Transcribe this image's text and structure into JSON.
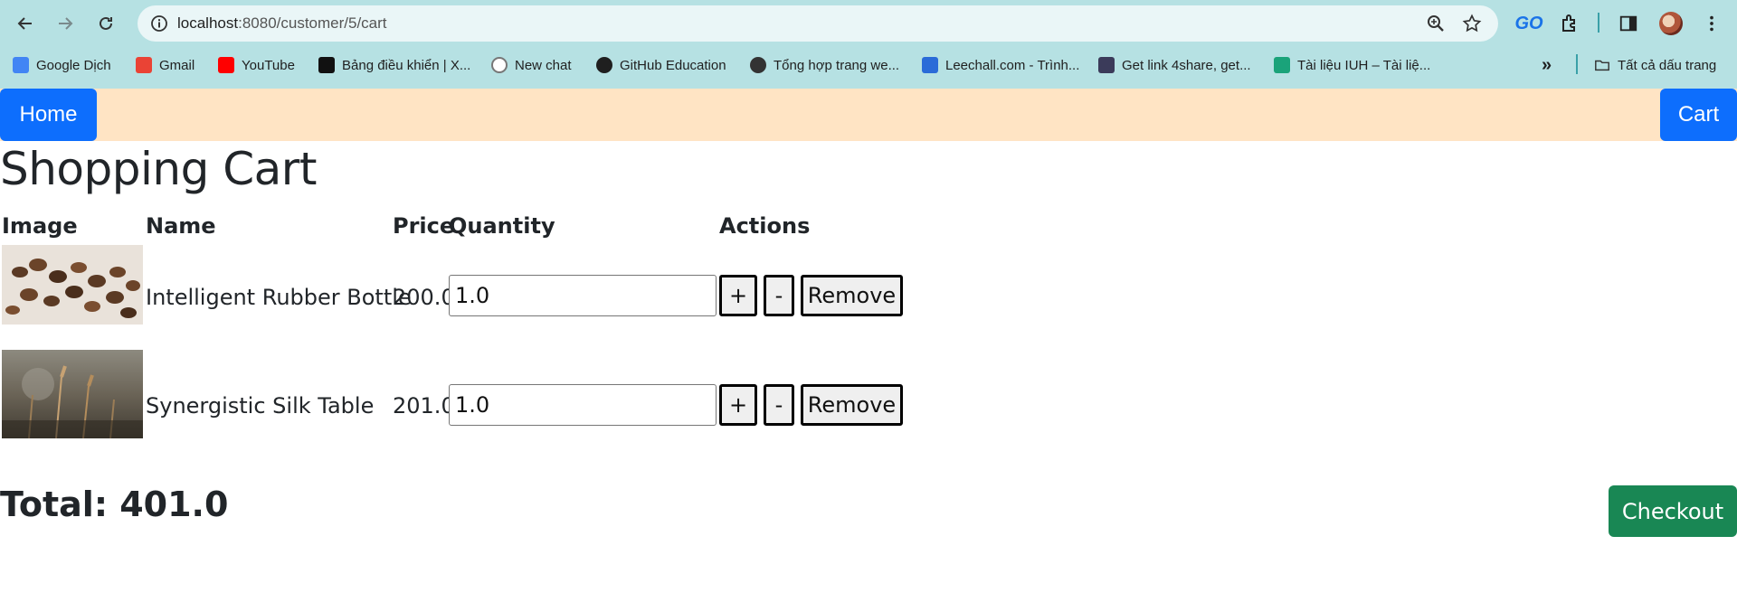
{
  "browser": {
    "url_host": "localhost",
    "url_rest": ":8080/customer/5/cart",
    "go_badge": "GO",
    "bookmarks": [
      {
        "label": "Google Dịch",
        "icon": "google-translate-icon",
        "color": "#4285f4"
      },
      {
        "label": "Gmail",
        "icon": "gmail-icon",
        "color": "#ea4335"
      },
      {
        "label": "YouTube",
        "icon": "youtube-icon",
        "color": "#ff0000"
      },
      {
        "label": "Bảng điều khiển | X...",
        "icon": "hostinger-icon",
        "color": "#111111"
      },
      {
        "label": "New chat",
        "icon": "chatgpt-icon",
        "color": "#777777"
      },
      {
        "label": "GitHub Education",
        "icon": "github-icon",
        "color": "#1f1f1f"
      },
      {
        "label": "Tổng hợp trang we...",
        "icon": "globe-icon",
        "color": "#333333"
      },
      {
        "label": "Leechall.com - Trình...",
        "icon": "leechall-icon",
        "color": "#2a6bd8"
      },
      {
        "label": "Get link 4share, get...",
        "icon": "n-icon",
        "color": "#3b3b5a"
      },
      {
        "label": "Tài liệu IUH – Tài liệ...",
        "icon": "book-icon",
        "color": "#1aa37a"
      }
    ],
    "all_bookmarks_label": "Tất cả dấu trang"
  },
  "nav": {
    "home_label": "Home",
    "cart_label": "Cart"
  },
  "page": {
    "title": "Shopping Cart",
    "columns": {
      "image": "Image",
      "name": "Name",
      "price": "Price",
      "quantity": "Quantity",
      "actions": "Actions"
    },
    "items": [
      {
        "name": "Intelligent Rubber Bottle",
        "price": "200.0",
        "quantity": "1.0",
        "image": "coffee-beans"
      },
      {
        "name": "Synergistic Silk Table",
        "price": "201.0",
        "quantity": "1.0",
        "image": "grass-field"
      }
    ],
    "actions": {
      "plus": "+",
      "minus": "-",
      "remove": "Remove"
    },
    "total_label": "Total: 401.0",
    "checkout_label": "Checkout"
  },
  "colors": {
    "chrome_bg": "#b6e1e3",
    "navbar_bg": "#ffe4c4",
    "primary": "#0d6efd",
    "success": "#198754"
  }
}
